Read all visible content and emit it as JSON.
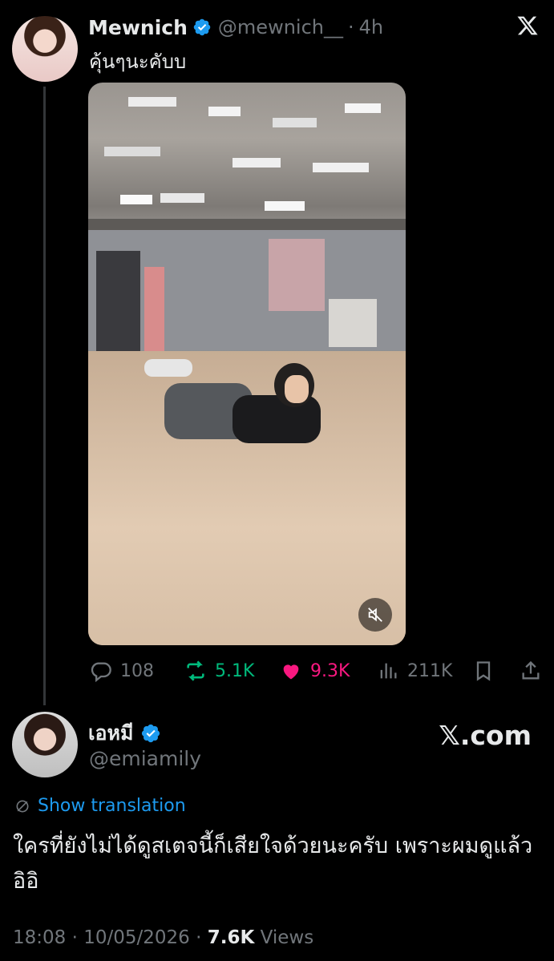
{
  "tweet": {
    "author_name": "Mewnich",
    "handle": "@mewnich__",
    "separator": "·",
    "time": "4h",
    "text": "คุ้นๆนะคับบ",
    "actions": {
      "replies": "108",
      "reposts": "5.1K",
      "likes": "9.3K",
      "views": "211K"
    }
  },
  "quote": {
    "author_name": "เอหมี",
    "handle": "@emiamily",
    "brand": "𝕏.com",
    "translate_label": "Show translation",
    "text": "ใครที่ยังไม่ได้ดูสเตจนี้ก็เสียใจด้วยนะครับ เพราะผมดูแล้ว อิอิ",
    "date_time": "18:08 · 10/05/2026 · ",
    "views_count": "7.6K",
    "views_label": " Views"
  },
  "colors": {
    "background": "#000000",
    "text": "#e7e9ea",
    "muted": "#71767b",
    "verified": "#1d9bf0",
    "repost": "#00ba7c",
    "like": "#f91880"
  },
  "icons": [
    "x-logo-icon",
    "verified-badge-icon",
    "mute-icon",
    "reply-icon",
    "repost-icon",
    "like-icon",
    "views-icon",
    "bookmark-icon",
    "share-icon",
    "translate-icon"
  ]
}
